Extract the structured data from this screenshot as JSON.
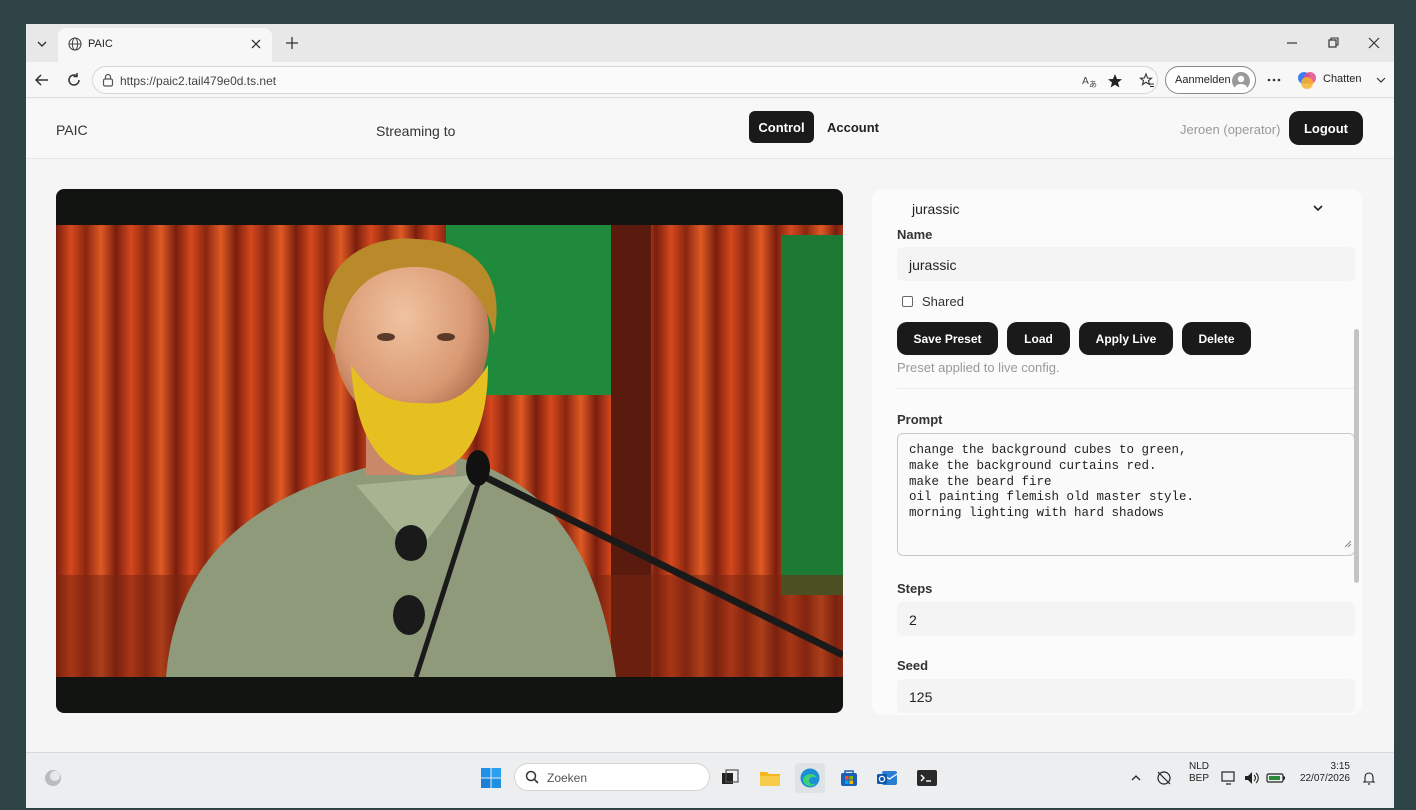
{
  "browser": {
    "tab_title": "PAIC",
    "url": "https://paic2.tail479e0d.ts.net",
    "signin_label": "Aanmelden",
    "copilot_label": "Chatten"
  },
  "app": {
    "brand": "PAIC",
    "streaming_label": "Streaming to",
    "nav": {
      "control": "Control",
      "account": "Account"
    },
    "user_label": "Jeroen (operator)",
    "logout_label": "Logout"
  },
  "panel": {
    "preset_selected": "jurassic",
    "name_label": "Name",
    "name_value": "jurassic",
    "shared_label": "Shared",
    "shared_checked": false,
    "buttons": {
      "save": "Save Preset",
      "load": "Load",
      "apply": "Apply Live",
      "delete": "Delete"
    },
    "status_text": "Preset applied to live config.",
    "prompt_label": "Prompt",
    "prompt_lines": [
      "change the background cubes to green,",
      "make the background curtains red.",
      "make the beard fire",
      "oil painting flemish old master style.",
      "morning lighting with hard shadows"
    ],
    "steps_label": "Steps",
    "steps_value": "2",
    "seed_label": "Seed",
    "seed_value": "125"
  },
  "taskbar": {
    "search_placeholder": "Zoeken",
    "lang_1": "NLD",
    "lang_2": "BEP",
    "time": "3:15",
    "date": "22/07/2026"
  },
  "colors": {
    "desktop": "#2f4446",
    "dark_button": "#1a1a1a",
    "curtain_red": "#c8401a",
    "cube_green": "#1f8a3c"
  }
}
